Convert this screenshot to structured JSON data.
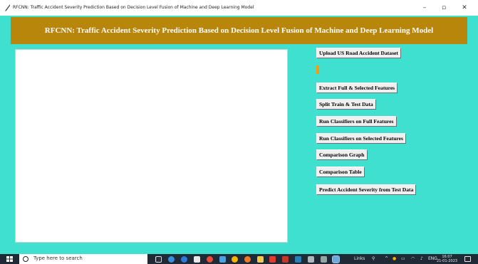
{
  "window": {
    "title": "RFCNN: Traffic Accident Severity Prediction Based on Decision Level Fusion of Machine and Deep Learning Model",
    "minimize": "–",
    "maximize": "▫",
    "close": "✕"
  },
  "header": {
    "heading": "RFCNN: Traffic Accident Severity Prediction Based on Decision Level Fusion of Machine and Deep Learning Model"
  },
  "buttons": {
    "upload": "Upload US Road Accident Dataset",
    "extract": "Extract Full & Selected Features",
    "split": "Split Train & Test Data",
    "run_full": "Run Classifiers on Full Features",
    "run_selected": "Run Classifiers on Selected Features",
    "comparison_graph": "Comparison Graph",
    "comparison_table": "Comparison Table",
    "predict": "Predict Accident Severity from Test Data"
  },
  "taskbar": {
    "search_placeholder": "Type here to search",
    "links": "Links",
    "clock_time": "16:07",
    "clock_date": "21-01-2023"
  },
  "colors": {
    "background": "#40e0d0",
    "banner": "#b8860b",
    "file_label": "#f39c12"
  }
}
